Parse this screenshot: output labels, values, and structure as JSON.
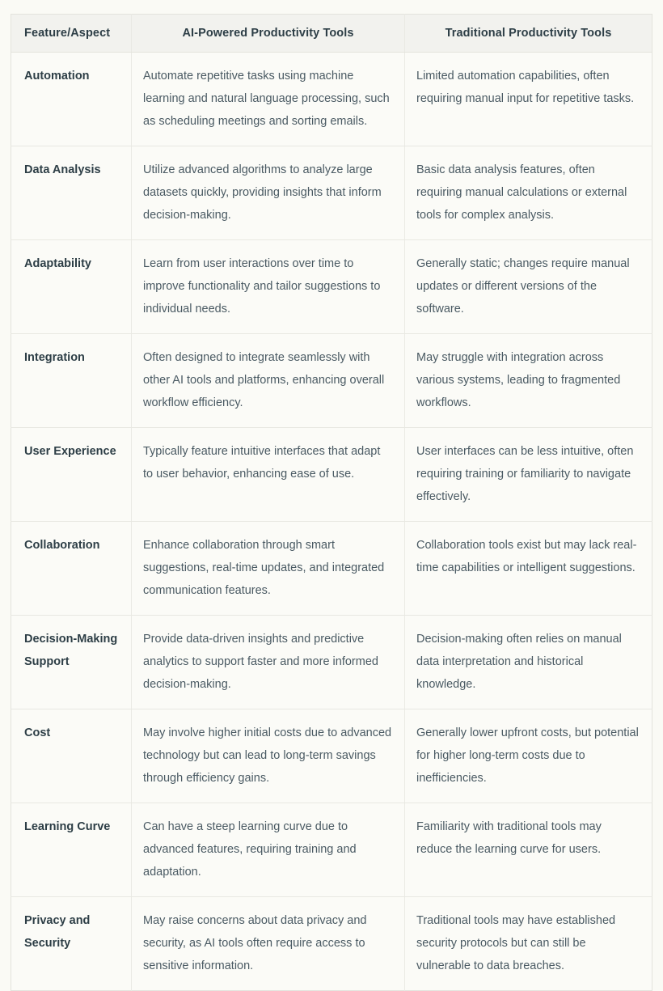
{
  "table": {
    "headers": [
      "Feature/Aspect",
      "AI-Powered Productivity Tools",
      "Traditional Productivity Tools"
    ],
    "rows": [
      {
        "feature": "Automation",
        "ai": "Automate repetitive tasks using machine learning and natural language processing, such as scheduling meetings and sorting emails.",
        "traditional": "Limited automation capabilities, often requiring manual input for repetitive tasks."
      },
      {
        "feature": "Data Analysis",
        "ai": "Utilize advanced algorithms to analyze large datasets quickly, providing insights that inform decision-making.",
        "traditional": "Basic data analysis features, often requiring manual calculations or external tools for complex analysis."
      },
      {
        "feature": "Adaptability",
        "ai": "Learn from user interactions over time to improve functionality and tailor suggestions to individual needs.",
        "traditional": "Generally static; changes require manual updates or different versions of the software."
      },
      {
        "feature": "Integration",
        "ai": "Often designed to integrate seamlessly with other AI tools and platforms, enhancing overall workflow efficiency.",
        "traditional": "May struggle with integration across various systems, leading to fragmented workflows."
      },
      {
        "feature": "User Experience",
        "ai": "Typically feature intuitive interfaces that adapt to user behavior, enhancing ease of use.",
        "traditional": "User interfaces can be less intuitive, often requiring training or familiarity to navigate effectively."
      },
      {
        "feature": "Collaboration",
        "ai": "Enhance collaboration through smart suggestions, real-time updates, and integrated communication features.",
        "traditional": "Collaboration tools exist but may lack real-time capabilities or intelligent suggestions."
      },
      {
        "feature": "Decision-Making Support",
        "ai": "Provide data-driven insights and predictive analytics to support faster and more informed decision-making.",
        "traditional": "Decision-making often relies on manual data interpretation and historical knowledge."
      },
      {
        "feature": "Cost",
        "ai": "May involve higher initial costs due to advanced technology but can lead to long-term savings through efficiency gains.",
        "traditional": "Generally lower upfront costs, but potential for higher long-term costs due to inefficiencies."
      },
      {
        "feature": "Learning Curve",
        "ai": "Can have a steep learning curve due to advanced features, requiring training and adaptation.",
        "traditional": "Familiarity with traditional tools may reduce the learning curve for users."
      },
      {
        "feature": "Privacy and Security",
        "ai": "May raise concerns about data privacy and security, as AI tools often require access to sensitive information.",
        "traditional": "Traditional tools may have established security protocols but can still be vulnerable to data breaches."
      }
    ]
  },
  "colors": {
    "page_background": "#fafaf5",
    "table_background": "#fbfbf7",
    "header_background": "#f2f2ee",
    "header_text": "#2d3e46",
    "body_text": "#4a5a63",
    "border": "#e3e3dd"
  }
}
